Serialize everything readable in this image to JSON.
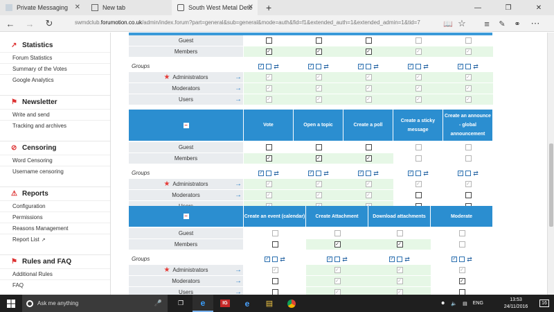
{
  "browser": {
    "tabs": [
      {
        "label": "Private Messaging",
        "close": "✕"
      },
      {
        "label": "New tab"
      },
      {
        "label": "South West Metal Dete",
        "close": "✕"
      }
    ],
    "new_tab": "+",
    "url_prefix": "swmdclub.",
    "url_domain": "forumotion.co.uk",
    "url_path": "/admin/index.forum?part=general&sub=general&mode=auth&fid=f1&extended_auth=1&extended_admin=1&tid=7"
  },
  "sidebar": {
    "sections": [
      {
        "title": "Statistics",
        "icon": "chart-icon",
        "items": [
          "Forum Statistics",
          "Summary of the Votes",
          "Google Analytics"
        ]
      },
      {
        "title": "Newsletter",
        "icon": "megaphone-icon",
        "items": [
          "Write and send",
          "Tracking and archives"
        ]
      },
      {
        "title": "Censoring",
        "icon": "ban-icon",
        "items": [
          "Word Censoring",
          "Username censoring"
        ]
      },
      {
        "title": "Reports",
        "icon": "warning-icon",
        "items": [
          "Configuration",
          "Permissions",
          "Reasons Management",
          "Report List"
        ]
      },
      {
        "title": "Rules and FAQ",
        "icon": "megaphone-icon",
        "items": [
          "Additional Rules",
          "FAQ"
        ]
      }
    ]
  },
  "labels": {
    "guest": "Guest",
    "members": "Members",
    "groups": "Groups",
    "administrators": "Administrators",
    "moderators": "Moderators",
    "users": "Users"
  },
  "table2": {
    "columns": [
      "Vote",
      "Open a topic",
      "Create a poll",
      "Create a sticky message",
      "Create an announce - global announcement"
    ]
  },
  "table3": {
    "columns": [
      "Create an event (calendar)",
      "Create Attachment",
      "Download attachments",
      "Moderate"
    ]
  },
  "taskbar": {
    "search_placeholder": "Ask me anything",
    "language": "ENG",
    "time": "13:53",
    "date": "24/11/2016",
    "notifications": "16"
  }
}
